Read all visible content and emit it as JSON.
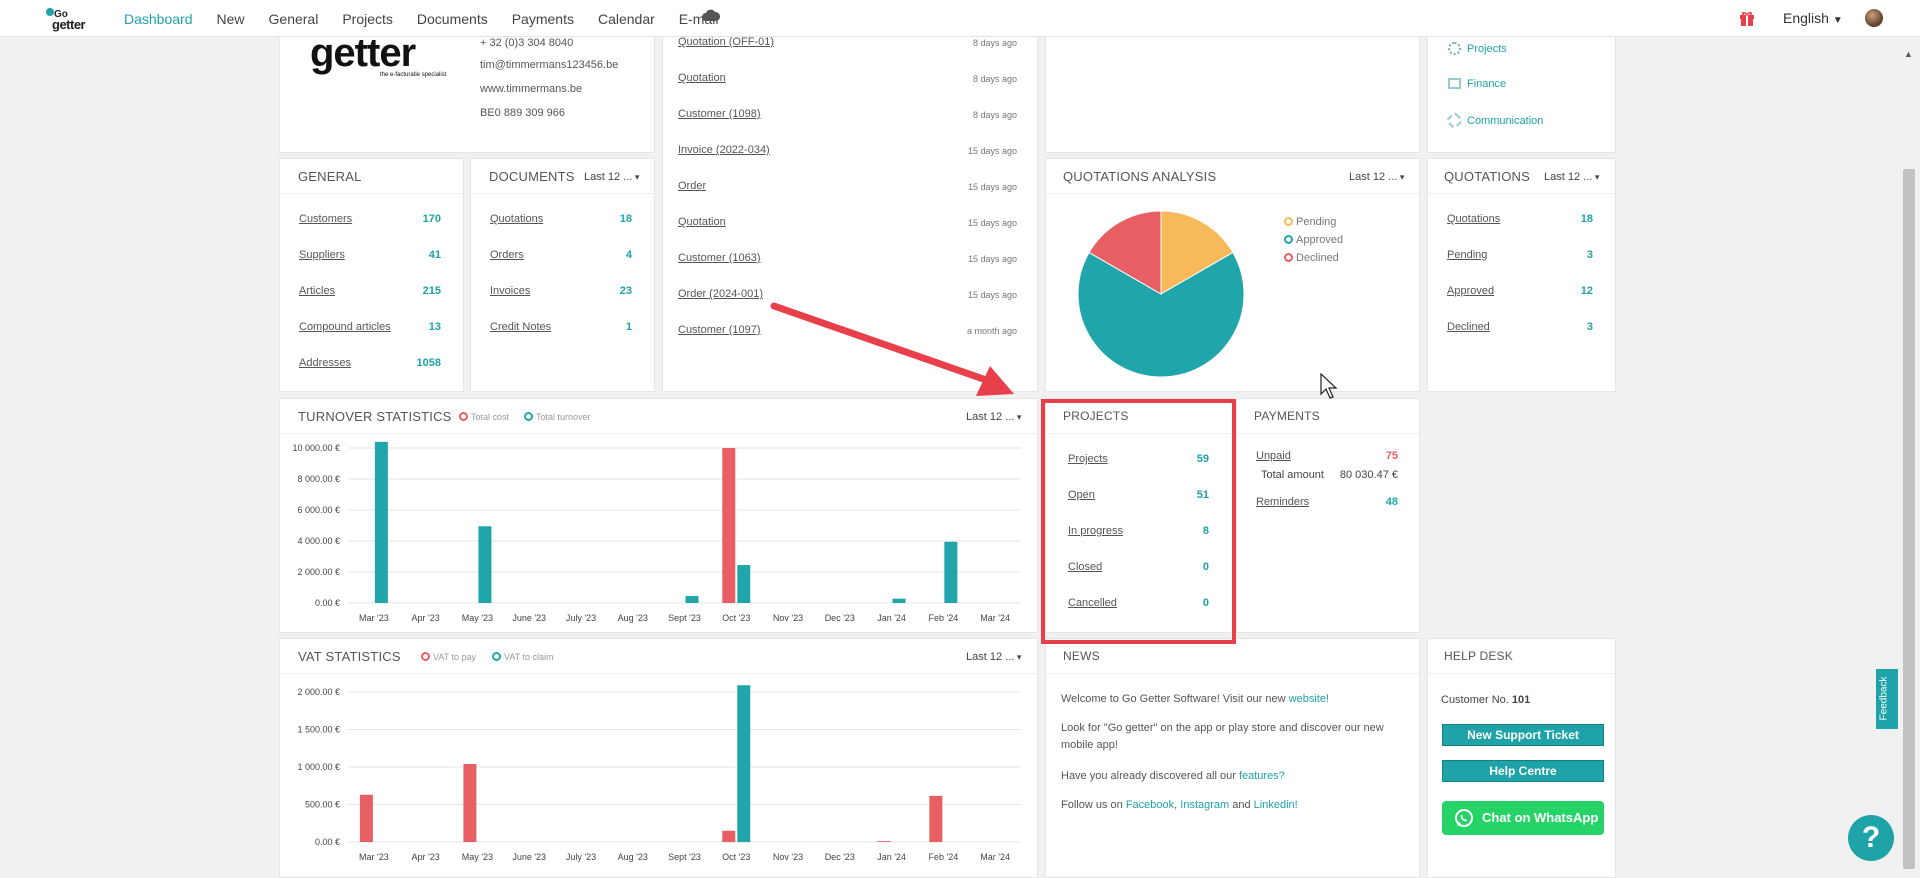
{
  "nav": {
    "logo_top": "Go",
    "logo_bottom": "getter",
    "items": [
      "Dashboard",
      "New",
      "General",
      "Projects",
      "Documents",
      "Payments",
      "Calendar",
      "E-mail"
    ],
    "language": "English"
  },
  "company": {
    "logo_text": "getter",
    "logo_tagline": "the e-facturatie specialist",
    "phone": "+ 32 (0)3 304 8040",
    "email": "tim@timmermans123456.be",
    "website": "www.timmermans.be",
    "vat": "BE0 889 309 966"
  },
  "recent": [
    {
      "label": "Quotation (OFF-01)",
      "date": "8 days ago"
    },
    {
      "label": "Quotation",
      "date": "8 days ago"
    },
    {
      "label": "Customer (1098)",
      "date": "8 days ago"
    },
    {
      "label": "Invoice (2022-034)",
      "date": "15 days ago"
    },
    {
      "label": "Order",
      "date": "15 days ago"
    },
    {
      "label": "Quotation",
      "date": "15 days ago"
    },
    {
      "label": "Customer (1063)",
      "date": "15 days ago"
    },
    {
      "label": "Order (2024-001)",
      "date": "15 days ago"
    },
    {
      "label": "Customer (1097)",
      "date": "a month ago"
    }
  ],
  "quick_links": [
    "Projects",
    "Finance",
    "Communication"
  ],
  "general": {
    "title": "GENERAL",
    "rows": [
      {
        "label": "Customers",
        "value": "170"
      },
      {
        "label": "Suppliers",
        "value": "41"
      },
      {
        "label": "Articles",
        "value": "215"
      },
      {
        "label": "Compound articles",
        "value": "13"
      },
      {
        "label": "Addresses",
        "value": "1058"
      }
    ]
  },
  "documents": {
    "title": "DOCUMENTS",
    "period": "Last 12 ...",
    "rows": [
      {
        "label": "Quotations",
        "value": "18"
      },
      {
        "label": "Orders",
        "value": "4"
      },
      {
        "label": "Invoices",
        "value": "23"
      },
      {
        "label": "Credit Notes",
        "value": "1"
      }
    ]
  },
  "quotations_analysis": {
    "title": "QUOTATIONS ANALYSIS",
    "period": "Last 12 ...",
    "legend": [
      "Pending",
      "Approved",
      "Declined"
    ],
    "colors": {
      "pending": "#f8b95b",
      "approved": "#20a5ab",
      "declined": "#e85f63"
    }
  },
  "quotations": {
    "title": "QUOTATIONS",
    "period": "Last 12 ...",
    "rows": [
      {
        "label": "Quotations",
        "value": "18"
      },
      {
        "label": "Pending",
        "value": "3"
      },
      {
        "label": "Approved",
        "value": "12"
      },
      {
        "label": "Declined",
        "value": "3"
      }
    ]
  },
  "turnover": {
    "title": "TURNOVER STATISTICS",
    "period": "Last 12 ...",
    "legend_cost": "Total cost",
    "legend_turnover": "Total turnover"
  },
  "vat": {
    "title": "VAT STATISTICS",
    "period": "Last 12 ...",
    "legend_pay": "VAT to pay",
    "legend_claim": "VAT to claim"
  },
  "projects": {
    "title": "PROJECTS",
    "rows": [
      {
        "label": "Projects",
        "value": "59"
      },
      {
        "label": "Open",
        "value": "51"
      },
      {
        "label": "In progress",
        "value": "8"
      },
      {
        "label": "Closed",
        "value": "0"
      },
      {
        "label": "Cancelled",
        "value": "0"
      }
    ]
  },
  "payments": {
    "title": "PAYMENTS",
    "unpaid_label": "Unpaid",
    "unpaid_value": "75",
    "total_label": "Total amount",
    "total_value": "80 030.47 €",
    "reminders_label": "Reminders",
    "reminders_value": "48"
  },
  "news": {
    "title": "NEWS",
    "p1": "Welcome to Go Getter Software! Visit our new",
    "p1_link": "website!",
    "p2": "Look for \"Go getter\" on the app or play store and discover our new mobile app!",
    "p3": "Have you already discovered all our",
    "p3_link": "features?",
    "p4": "Follow us on",
    "p4_facebook": "Facebook",
    "p4_instagram": "Instagram",
    "p4_and": "and",
    "p4_linkedin": "Linkedin!"
  },
  "helpdesk": {
    "title": "HELP DESK",
    "customer_label": "Customer No.",
    "customer_no": "101",
    "new_ticket": "New Support Ticket",
    "help_centre": "Help Centre",
    "whatsapp": "Chat on WhatsApp"
  },
  "feedback_label": "Feedback",
  "help_label": "?",
  "chart_data": [
    {
      "type": "bar",
      "title": "TURNOVER STATISTICS",
      "categories": [
        "Mar '23",
        "Apr '23",
        "May '23",
        "June '23",
        "July '23",
        "Aug '23",
        "Sept '23",
        "Oct '23",
        "Nov '23",
        "Dec '23",
        "Jan '24",
        "Feb '24",
        "Mar '24"
      ],
      "series": [
        {
          "name": "Total cost",
          "color": "#e85f63",
          "values": [
            0,
            0,
            0,
            0,
            0,
            0,
            0,
            10000,
            0,
            0,
            0,
            0,
            0
          ]
        },
        {
          "name": "Total turnover",
          "color": "#20a5ab",
          "values": [
            10400,
            0,
            4950,
            0,
            0,
            0,
            450,
            2450,
            0,
            0,
            280,
            3950,
            0
          ]
        }
      ],
      "yticks": [
        "0.00 €",
        "2 000.00 €",
        "4 000.00 €",
        "6 000.00 €",
        "8 000.00 €",
        "10 000.00 €"
      ],
      "ylim": [
        0,
        10000
      ],
      "grid": true
    },
    {
      "type": "bar",
      "title": "VAT STATISTICS",
      "categories": [
        "Mar '23",
        "Apr '23",
        "May '23",
        "June '23",
        "July '23",
        "Aug '23",
        "Sept '23",
        "Oct '23",
        "Nov '23",
        "Dec '23",
        "Jan '24",
        "Feb '24",
        "Mar '24"
      ],
      "series": [
        {
          "name": "VAT to pay",
          "color": "#e85f63",
          "values": [
            630,
            0,
            1040,
            0,
            0,
            0,
            0,
            150,
            0,
            0,
            12,
            615,
            0
          ]
        },
        {
          "name": "VAT to claim",
          "color": "#20a5ab",
          "values": [
            0,
            0,
            0,
            0,
            0,
            0,
            0,
            2090,
            0,
            0,
            0,
            0,
            0
          ]
        }
      ],
      "yticks": [
        "0.00 €",
        "500.00 €",
        "1 000.00 €",
        "1 500.00 €",
        "2 000.00 €"
      ],
      "ylim": [
        0,
        2000
      ],
      "grid": true
    },
    {
      "type": "pie",
      "title": "QUOTATIONS ANALYSIS",
      "categories": [
        "Pending",
        "Approved",
        "Declined"
      ],
      "values": [
        3,
        12,
        3
      ]
    }
  ]
}
